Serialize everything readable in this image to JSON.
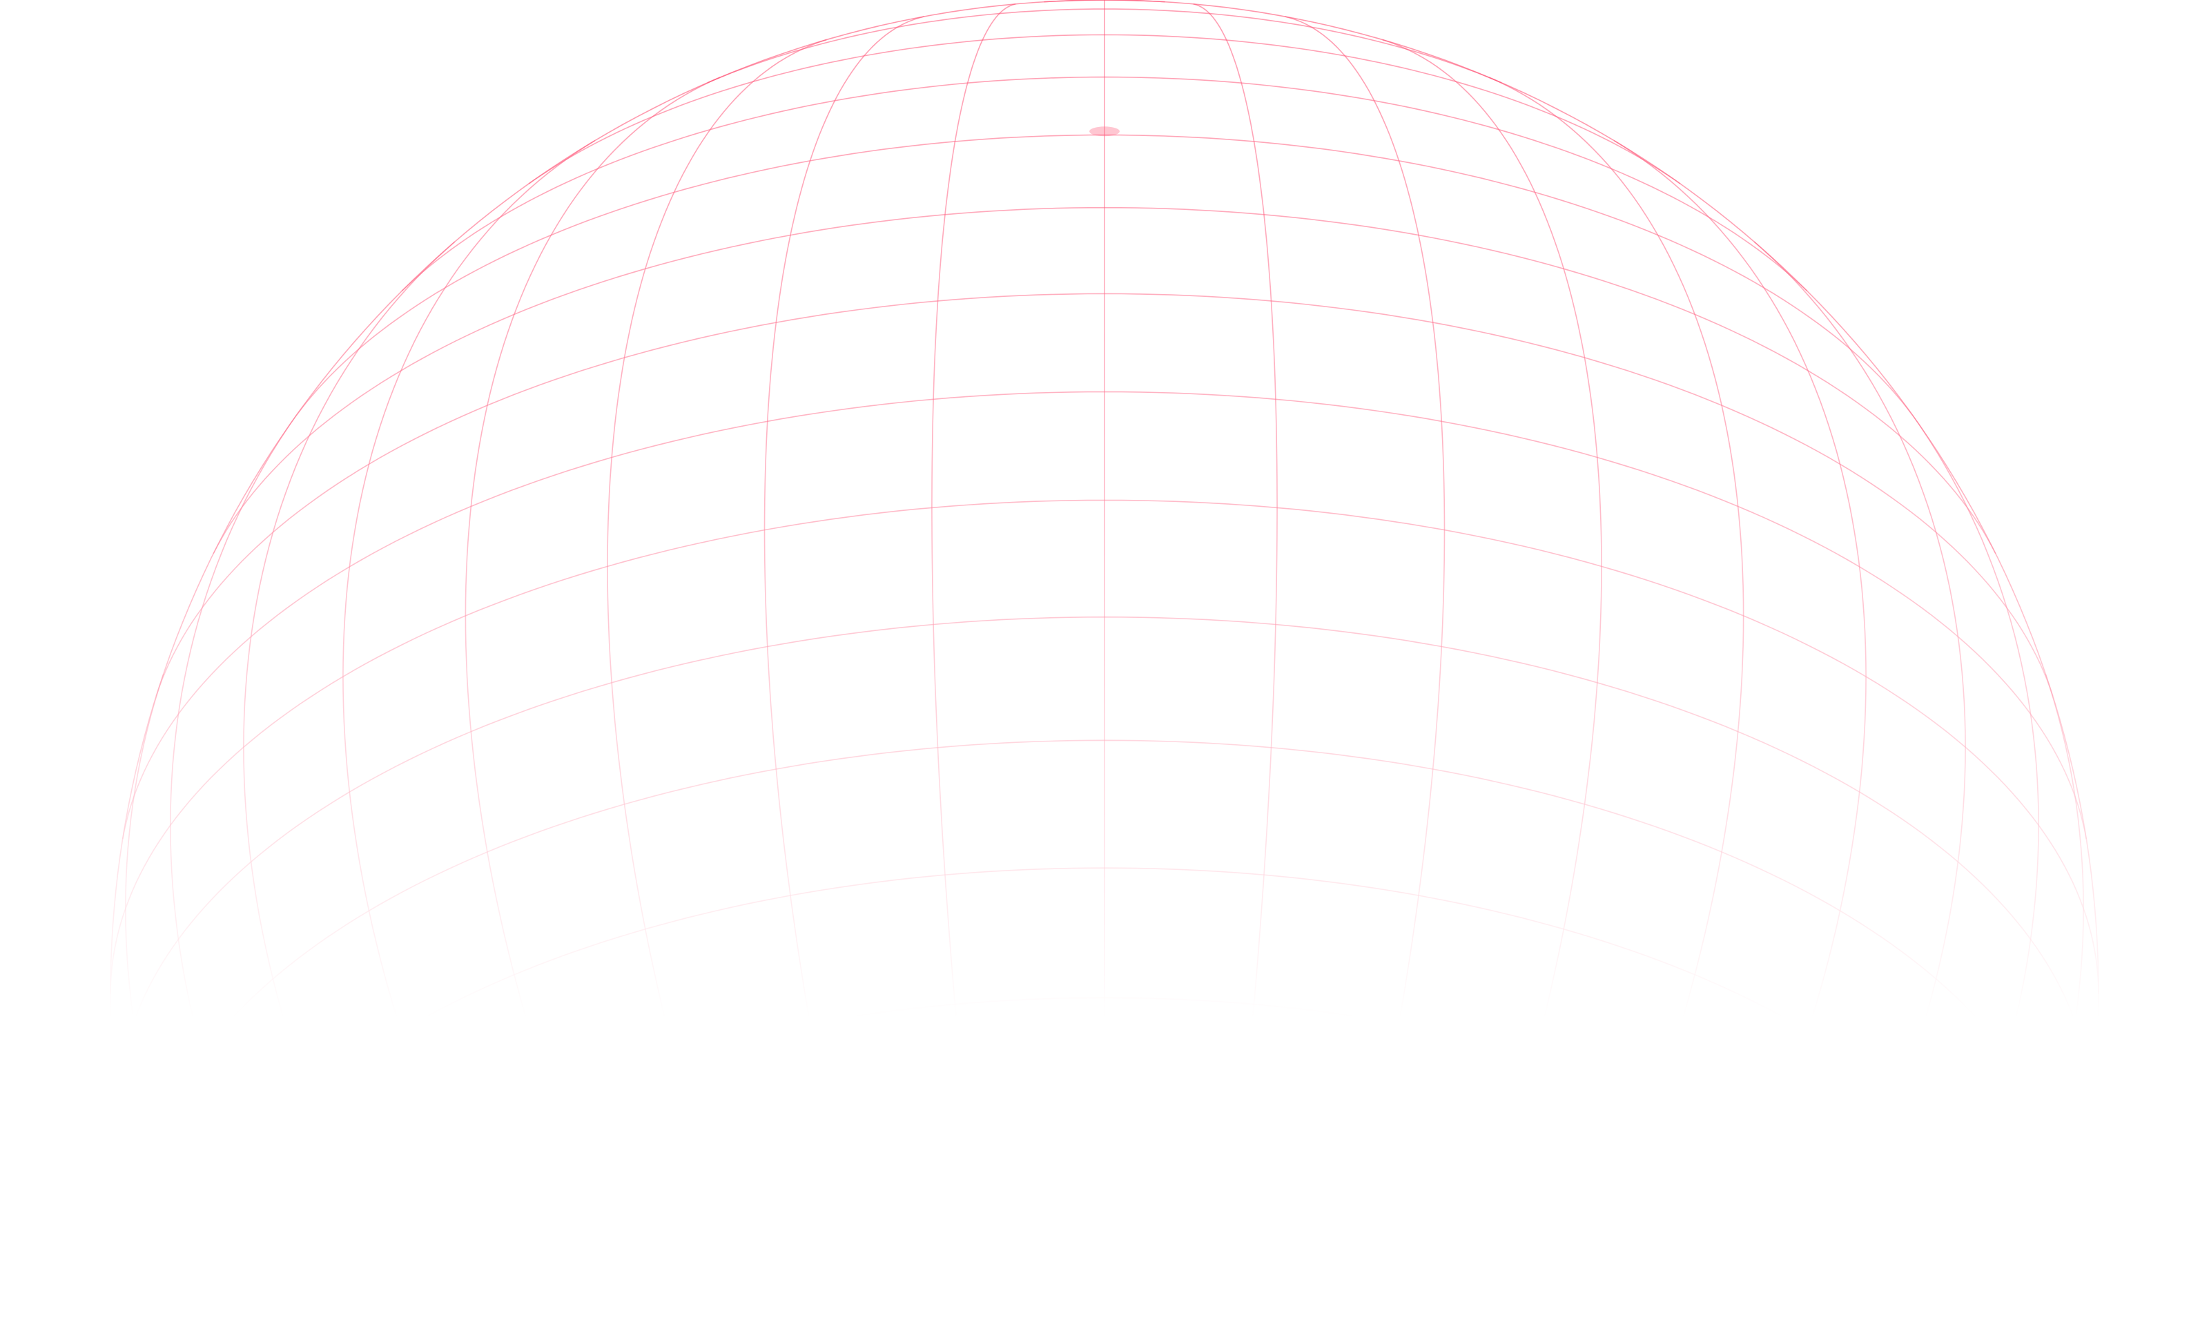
{
  "background": {
    "color": "#ffffff"
  },
  "globe": {
    "icon": "wireframe-globe-icon",
    "line_color": "#ff4f72",
    "meridian_count": 36,
    "parallel_count": 24,
    "fades_toward_bottom": true,
    "north_pole_visible": true
  }
}
